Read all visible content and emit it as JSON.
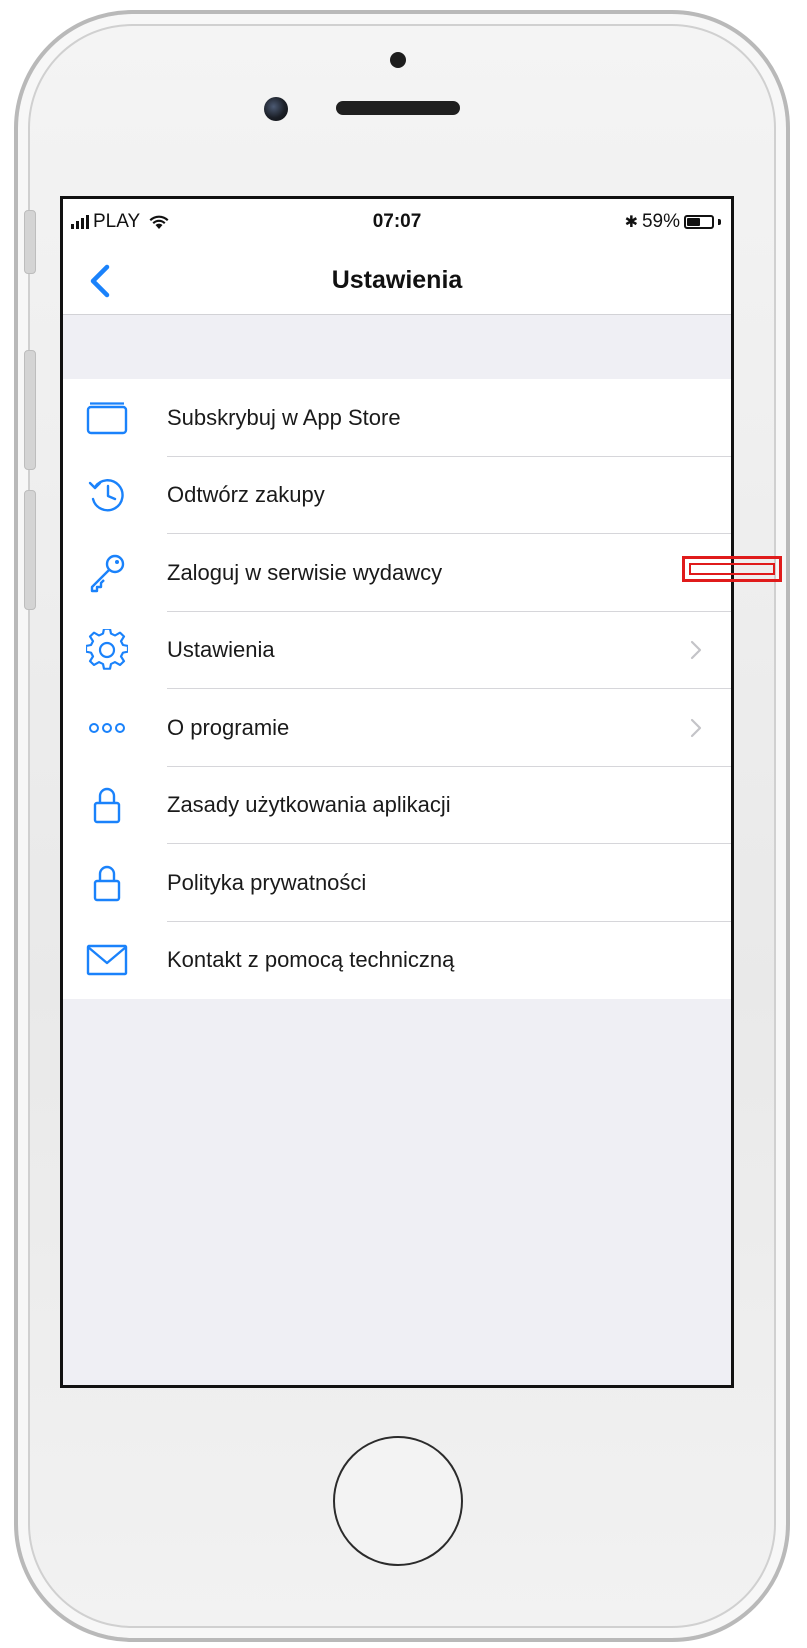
{
  "status_bar": {
    "carrier": "PLAY",
    "time": "07:07",
    "bluetooth_symbol": "✱",
    "battery_text": "59%",
    "battery_level_percent": 59
  },
  "nav": {
    "title": "Ustawienia",
    "back_icon": "chevron-left-icon"
  },
  "menu": [
    {
      "label": "Subskrybuj w App Store",
      "icon": "app-store-card-icon",
      "has_chevron": false
    },
    {
      "label": "Odtwórz zakupy",
      "icon": "restore-history-icon",
      "has_chevron": false
    },
    {
      "label": "Zaloguj w serwisie wydawcy",
      "icon": "key-icon",
      "has_chevron": false
    },
    {
      "label": "Ustawienia",
      "icon": "gear-icon",
      "has_chevron": true
    },
    {
      "label": "O programie",
      "icon": "more-dots-icon",
      "has_chevron": true
    },
    {
      "label": "Zasady użytkowania aplikacji",
      "icon": "lock-icon",
      "has_chevron": false
    },
    {
      "label": "Polityka prywatności",
      "icon": "lock-icon",
      "has_chevron": false
    },
    {
      "label": "Kontakt z pomocą techniczną",
      "icon": "mail-icon",
      "has_chevron": false
    }
  ],
  "colors": {
    "accent": "#1a82fb",
    "annotation": "#e01b1b",
    "background_grouped": "#efeff4"
  }
}
